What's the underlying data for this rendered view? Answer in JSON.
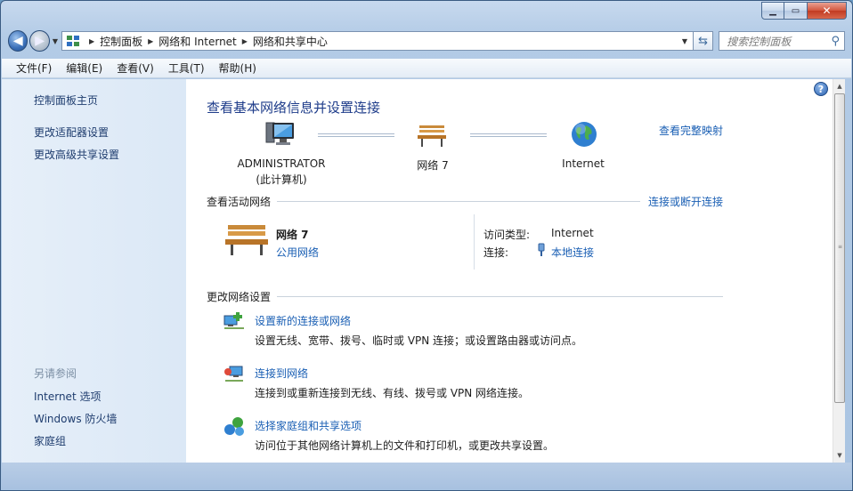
{
  "window": {
    "buttons": {
      "minimize": "▁",
      "maximize": "▭",
      "close": "✕"
    }
  },
  "nav": {
    "back_glyph": "◀",
    "forward_glyph": "▶",
    "breadcrumbs": [
      "控制面板",
      "网络和 Internet",
      "网络和共享中心"
    ],
    "search_placeholder": "搜索控制面板"
  },
  "menu": [
    "文件(F)",
    "编辑(E)",
    "查看(V)",
    "工具(T)",
    "帮助(H)"
  ],
  "sidebar": {
    "links": [
      "控制面板主页",
      "更改适配器设置",
      "更改高级共享设置"
    ],
    "see_also_heading": "另请参阅",
    "see_also": [
      "Internet 选项",
      "Windows 防火墙",
      "家庭组"
    ]
  },
  "main": {
    "title": "查看基本网络信息并设置连接",
    "full_map_link": "查看完整映射",
    "map_nodes": [
      {
        "label": "ADMINISTRATOR",
        "sublabel": "(此计算机)",
        "icon": "computer-icon"
      },
      {
        "label": "网络  7",
        "icon": "bench-icon"
      },
      {
        "label": "Internet",
        "icon": "globe-icon"
      }
    ],
    "active_networks": {
      "heading": "查看活动网络",
      "connect_link": "连接或断开连接",
      "network_name": "网络  7",
      "network_type": "公用网络",
      "access_type_label": "访问类型:",
      "access_type_value": "Internet",
      "connection_label": "连接:",
      "connection_value": "本地连接"
    },
    "change_settings": {
      "heading": "更改网络设置",
      "items": [
        {
          "title": "设置新的连接或网络",
          "desc": "设置无线、宽带、拨号、临时或 VPN 连接；或设置路由器或访问点。",
          "icon": "new-connection-icon"
        },
        {
          "title": "连接到网络",
          "desc": "连接到或重新连接到无线、有线、拨号或 VPN 网络连接。",
          "icon": "connect-network-icon"
        },
        {
          "title": "选择家庭组和共享选项",
          "desc": "访问位于其他网络计算机上的文件和打印机，或更改共享设置。",
          "icon": "homegroup-icon"
        }
      ]
    }
  },
  "colors": {
    "link": "#1a5fb4",
    "title": "#1e3c8a",
    "sidebar_bg": "#dbe8f6"
  }
}
